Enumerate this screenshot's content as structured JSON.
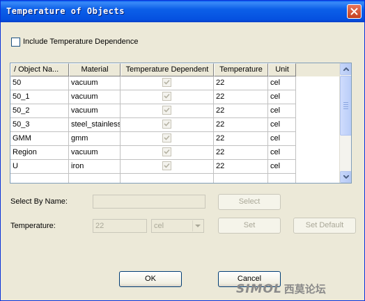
{
  "window": {
    "title": "Temperature of Objects"
  },
  "include_checkbox": {
    "label": "Include Temperature Dependence",
    "checked": false
  },
  "table": {
    "columns": [
      "/   Object Na...",
      "Material",
      "Temperature Dependent",
      "Temperature",
      "Unit"
    ],
    "rows": [
      {
        "object": "50",
        "material": "vacuum",
        "temp_dependent": true,
        "temperature": "22",
        "unit": "cel"
      },
      {
        "object": "50_1",
        "material": "vacuum",
        "temp_dependent": true,
        "temperature": "22",
        "unit": "cel"
      },
      {
        "object": "50_2",
        "material": "vacuum",
        "temp_dependent": true,
        "temperature": "22",
        "unit": "cel"
      },
      {
        "object": "50_3",
        "material": "steel_stainless",
        "temp_dependent": true,
        "temperature": "22",
        "unit": "cel"
      },
      {
        "object": "GMM",
        "material": "gmm",
        "temp_dependent": true,
        "temperature": "22",
        "unit": "cel"
      },
      {
        "object": "Region",
        "material": "vacuum",
        "temp_dependent": true,
        "temperature": "22",
        "unit": "cel"
      },
      {
        "object": "U",
        "material": "iron",
        "temp_dependent": true,
        "temperature": "22",
        "unit": "cel"
      }
    ]
  },
  "select_by_name": {
    "label": "Select By Name:",
    "value": "",
    "button": "Select"
  },
  "temperature": {
    "label": "Temperature:",
    "value": "22",
    "unit": "cel",
    "set_button": "Set",
    "set_default_button": "Set Default"
  },
  "footer": {
    "ok": "OK",
    "cancel": "Cancel"
  },
  "watermark": {
    "latin": "SIMOL",
    "chinese": "西莫论坛"
  },
  "colors": {
    "titlebar": "#0c5fe8",
    "face": "#ece9d8",
    "disabled_text": "#a9a797"
  }
}
